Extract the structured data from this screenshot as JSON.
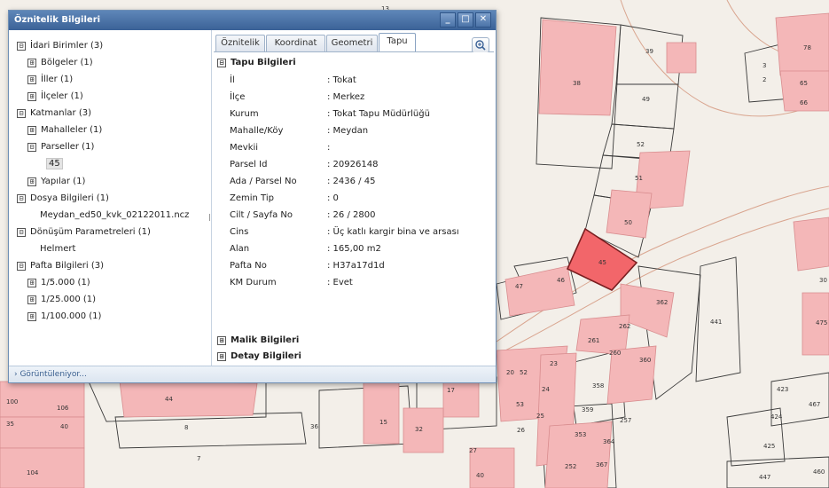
{
  "window": {
    "title": "Öznitelik Bilgileri",
    "buttons": {
      "minimize": "_",
      "maximize": "□",
      "close": "✕"
    }
  },
  "tree": [
    {
      "toggle": "⊟",
      "label": "İdari Birimler (3)"
    },
    {
      "toggle": "⊞",
      "label": "Bölgeler (1)"
    },
    {
      "toggle": "⊞",
      "label": "İller (1)"
    },
    {
      "toggle": "⊞",
      "label": "İlçeler (1)"
    },
    {
      "toggle": "⊟",
      "label": "Katmanlar (3)"
    },
    {
      "toggle": "⊞",
      "label": "Mahalleler (1)"
    },
    {
      "toggle": "⊟",
      "label": "Parseller (1)"
    },
    {
      "toggle": "",
      "label": "45"
    },
    {
      "toggle": "⊞",
      "label": "Yapılar (1)"
    },
    {
      "toggle": "⊟",
      "label": "Dosya Bilgileri (1)"
    },
    {
      "toggle": "",
      "label": "Meydan_ed50_kvk_02122011.ncz"
    },
    {
      "toggle": "⊟",
      "label": "Dönüşüm Parametreleri (1)"
    },
    {
      "toggle": "",
      "label": "Helmert"
    },
    {
      "toggle": "⊟",
      "label": "Pafta Bilgileri (3)"
    },
    {
      "toggle": "⊞",
      "label": "1/5.000 (1)"
    },
    {
      "toggle": "⊞",
      "label": "1/25.000 (1)"
    },
    {
      "toggle": "⊞",
      "label": "1/100.000 (1)"
    }
  ],
  "tabs": [
    "Öznitelik",
    "Koordinat",
    "Geometri",
    "Tapu"
  ],
  "sections": {
    "tapu": "Tapu Bilgileri",
    "malik": "Malik Bilgileri",
    "detay": "Detay Bilgileri",
    "collapse_toggle": "⊟",
    "expand_toggle": "⊞"
  },
  "tapu_rows": [
    {
      "key": "İl",
      "value": ": Tokat"
    },
    {
      "key": "İlçe",
      "value": ": Merkez"
    },
    {
      "key": "Kurum",
      "value": ": Tokat Tapu Müdürlüğü"
    },
    {
      "key": "Mahalle/Köy",
      "value": ": Meydan"
    },
    {
      "key": "Mevkii",
      "value": ":"
    },
    {
      "key": "Parsel Id",
      "value": ": 20926148"
    },
    {
      "key": "Ada / Parsel No",
      "value": ": 2436 / 45"
    },
    {
      "key": "Zemin Tip",
      "value": ": 0"
    },
    {
      "key": "Cilt / Sayfa No",
      "value": ": 26 / 2800"
    },
    {
      "key": "Cins",
      "value": ": Üç katlı kargir bina ve arsası"
    },
    {
      "key": "Alan",
      "value": ": 165,00 m2"
    },
    {
      "key": "Pafta No",
      "value": ": H37a17d1d"
    },
    {
      "key": "KM Durum",
      "value": ": Evet"
    }
  ],
  "status": "› Görüntüleniyor...",
  "map_labels": [
    "39",
    "38",
    "49",
    "52",
    "51",
    "50",
    "45",
    "46",
    "47",
    "362",
    "262",
    "261",
    "260",
    "360",
    "441",
    "78",
    "3",
    "2",
    "65",
    "66",
    "30",
    "475",
    "423",
    "467",
    "424",
    "425",
    "447",
    "460",
    "358",
    "359",
    "257",
    "353",
    "364",
    "252",
    "367",
    "20",
    "52",
    "23",
    "24",
    "53",
    "25",
    "26",
    "27",
    "40",
    "17",
    "15",
    "32",
    "36",
    "44",
    "106",
    "100",
    "35",
    "40",
    "8",
    "7",
    "104",
    "13"
  ],
  "colors": {
    "parcel_fill": "#f4b7b8",
    "selected_parcel": "#f2666a",
    "window_border": "#6f8fb5"
  }
}
